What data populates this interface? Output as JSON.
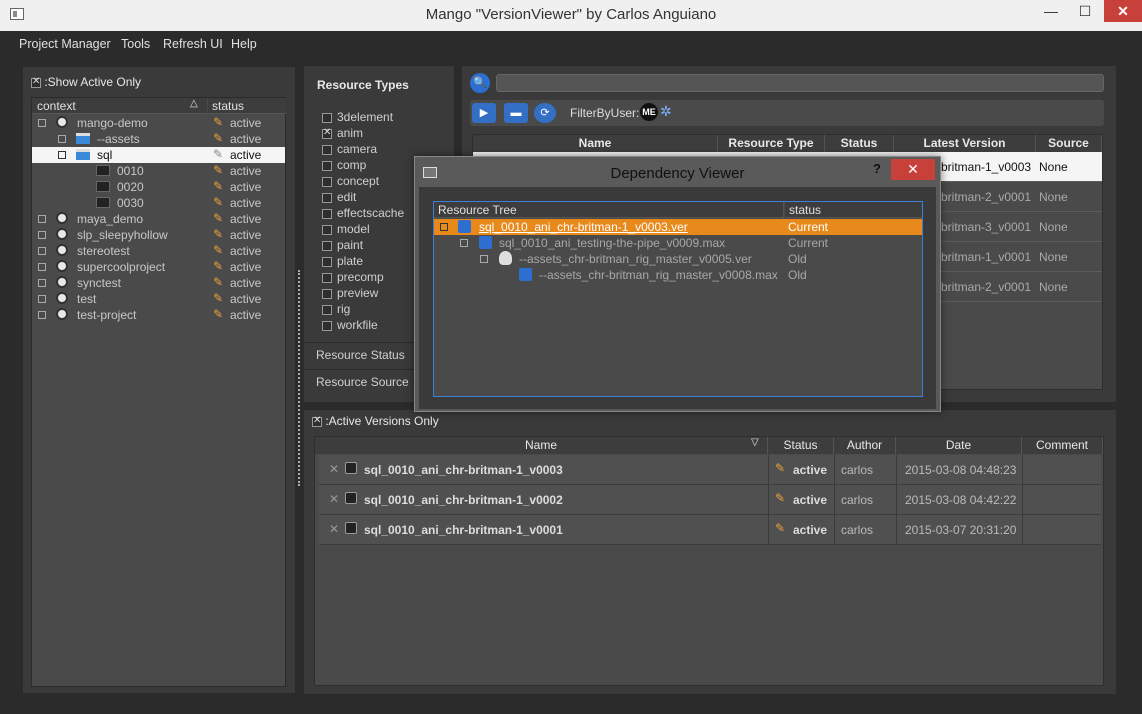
{
  "window": {
    "title": "Mango \"VersionViewer\" by Carlos Anguiano",
    "minimize": "—",
    "maximize": "☐",
    "close": "✕"
  },
  "menu": [
    "Project Manager",
    "Tools",
    "Refresh UI",
    "Help"
  ],
  "left": {
    "show_active_label": ":Show Active Only",
    "headers": {
      "context": "context",
      "status": "status"
    },
    "rows": [
      {
        "name": "mango-demo",
        "status": "active",
        "icon": "globe-icon"
      },
      {
        "name": "--assets",
        "status": "active",
        "icon": "clapper-icon"
      },
      {
        "name": "sql",
        "status": "active",
        "icon": "clapper-icon"
      },
      {
        "name": "0010",
        "status": "active",
        "icon": "film-icon"
      },
      {
        "name": "0020",
        "status": "active",
        "icon": "film-icon"
      },
      {
        "name": "0030",
        "status": "active",
        "icon": "film-icon"
      },
      {
        "name": "maya_demo",
        "status": "active",
        "icon": "globe-icon"
      },
      {
        "name": "slp_sleepyhollow",
        "status": "active",
        "icon": "globe-icon"
      },
      {
        "name": "stereotest",
        "status": "active",
        "icon": "globe-icon"
      },
      {
        "name": "supercoolproject",
        "status": "active",
        "icon": "globe-icon"
      },
      {
        "name": "synctest",
        "status": "active",
        "icon": "globe-icon"
      },
      {
        "name": "test",
        "status": "active",
        "icon": "globe-icon"
      },
      {
        "name": "test-project",
        "status": "active",
        "icon": "globe-icon"
      }
    ]
  },
  "resource_types": {
    "header": "Resource Types",
    "items": [
      "3delement",
      "anim",
      "camera",
      "comp",
      "concept",
      "edit",
      "effectscache",
      "model",
      "paint",
      "plate",
      "precomp",
      "preview",
      "rig",
      "workfile"
    ],
    "checked": "anim",
    "sections": [
      "Resource Status",
      "Resource Source"
    ]
  },
  "toolbar": {
    "filter_label": "FilterByUser:",
    "user_badge": "ME"
  },
  "resources": {
    "headers": [
      "Name",
      "Resource Type",
      "Status",
      "Latest Version",
      "Source"
    ],
    "rows": [
      {
        "latest": "britman-1_v0003",
        "source": "None"
      },
      {
        "latest": "britman-2_v0001",
        "source": "None"
      },
      {
        "latest": "britman-3_v0001",
        "source": "None"
      },
      {
        "latest": "britman-1_v0001",
        "source": "None"
      },
      {
        "latest": "britman-2_v0001",
        "source": "None"
      }
    ]
  },
  "versions": {
    "active_label": ":Active Versions Only",
    "headers": [
      "Name",
      "Status",
      "Author",
      "Date",
      "Comment"
    ],
    "rows": [
      {
        "name": "sql_0010_ani_chr-britman-1_v0003",
        "status": "active",
        "author": "carlos",
        "date": "2015-03-08 04:48:23",
        "comment": ""
      },
      {
        "name": "sql_0010_ani_chr-britman-1_v0002",
        "status": "active",
        "author": "carlos",
        "date": "2015-03-08 04:42:22",
        "comment": ""
      },
      {
        "name": "sql_0010_ani_chr-britman-1_v0001",
        "status": "active",
        "author": "carlos",
        "date": "2015-03-07 20:31:20",
        "comment": ""
      }
    ]
  },
  "dialog": {
    "title": "Dependency Viewer",
    "help": "?",
    "close": "✕",
    "headers": {
      "tree": "Resource Tree",
      "status": "status"
    },
    "rows": [
      {
        "name": "sql_0010_ani_chr-britman-1_v0003.ver",
        "status": "Current"
      },
      {
        "name": "sql_0010_ani_testing-the-pipe_v0009.max",
        "status": "Current"
      },
      {
        "name": "--assets_chr-britman_rig_master_v0005.ver",
        "status": "Old"
      },
      {
        "name": "--assets_chr-britman_rig_master_v0008.max",
        "status": "Old"
      }
    ]
  },
  "colors": {
    "accent_blue": "#2d6fd1",
    "selection_orange": "#e8891c",
    "close_red": "#c7403a",
    "pencil": "#e8a33a"
  }
}
